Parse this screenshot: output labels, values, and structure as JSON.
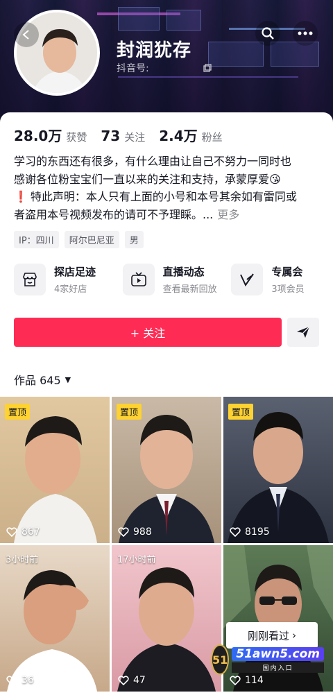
{
  "profile": {
    "nickname": "封润犹存",
    "douyin_id_label": "抖音号:"
  },
  "stats": [
    {
      "value": "28.0万",
      "label": "获赞"
    },
    {
      "value": "73",
      "label": "关注"
    },
    {
      "value": "2.4万",
      "label": "粉丝"
    }
  ],
  "bio": {
    "line1": "学习的东西还有很多，有什么理由让自己不努力一同时也",
    "line2": "感谢各位粉宝宝们一直以来的关注和支持，承蒙厚爱",
    "line2_emoji": "😘",
    "line3_mark": "❗",
    "line3": "特此声明：本人只有上面的小号和本号其余如有雷同或",
    "line4": "者盗用本号视频发布的请可不予理睬。...",
    "more": "更多"
  },
  "tags": [
    "IP：四川",
    "阿尔巴尼亚",
    "男"
  ],
  "features": [
    {
      "title": "探店足迹",
      "subtitle": "4家好店",
      "icon": "store-icon"
    },
    {
      "title": "直播动态",
      "subtitle": "查看最新回放",
      "icon": "tv-icon"
    },
    {
      "title": "专属会",
      "subtitle": "3项会员",
      "icon": "v-badge-icon"
    }
  ],
  "actions": {
    "follow_label": "+ 关注"
  },
  "works": {
    "label": "作品 645",
    "caret": "▼"
  },
  "videos": [
    {
      "badge": "置顶",
      "likes": "867"
    },
    {
      "badge": "置顶",
      "likes": "988"
    },
    {
      "badge": "置顶",
      "likes": "8195"
    },
    {
      "time": "3小时前",
      "likes": "36"
    },
    {
      "time": "17小时前",
      "likes": "47"
    },
    {
      "time": "",
      "likes": "114"
    }
  ],
  "overlay": {
    "recently_viewed": "刚刚看过",
    "recently_viewed_arrow": "›",
    "watermark_logo": "51",
    "watermark_main": "51awn5.com",
    "watermark_sub": "国内入口"
  },
  "colors": {
    "accent": "#fe2c55",
    "pin_badge": "#fdd231"
  }
}
